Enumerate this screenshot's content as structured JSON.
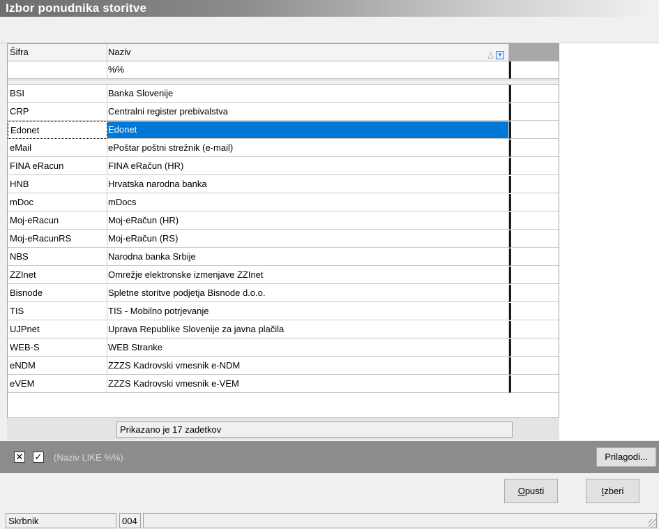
{
  "window": {
    "title": "Izbor ponudnika storitve"
  },
  "grid": {
    "headers": {
      "code": "Šifra",
      "name": "Naziv"
    },
    "filter": {
      "code": "",
      "name": "%%"
    },
    "rows": [
      {
        "code": "BSI",
        "name": "Banka Slovenije"
      },
      {
        "code": "CRP",
        "name": "Centralni register prebivalstva"
      },
      {
        "code": "Edonet",
        "name": "Edonet"
      },
      {
        "code": "eMail",
        "name": "ePoštar poštni strežnik (e-mail)"
      },
      {
        "code": "FINA eRacun",
        "name": "FINA eRačun (HR)"
      },
      {
        "code": "HNB",
        "name": "Hrvatska narodna banka"
      },
      {
        "code": "mDoc",
        "name": "mDocs"
      },
      {
        "code": "Moj-eRacun",
        "name": "Moj-eRačun (HR)"
      },
      {
        "code": "Moj-eRacunRS",
        "name": "Moj-eRačun (RS)"
      },
      {
        "code": "NBS",
        "name": "Narodna banka Srbije"
      },
      {
        "code": "ZZInet",
        "name": "Omrežje elektronske izmenjave ZZInet"
      },
      {
        "code": "Bisnode",
        "name": "Spletne storitve podjetja Bisnode d.o.o."
      },
      {
        "code": "TIS",
        "name": "TIS - Mobilno potrjevanje"
      },
      {
        "code": "UJPnet",
        "name": "Uprava Republike Slovenije za javna plačila"
      },
      {
        "code": "WEB-S",
        "name": "WEB Stranke"
      },
      {
        "code": "eNDM",
        "name": "ZZZS Kadrovski vmesnik e-NDM"
      },
      {
        "code": "eVEM",
        "name": "ZZZS Kadrovski vmesnik e-VEM"
      }
    ],
    "selected_index": 2,
    "count_text": "Prikazano je 17 zadetkov"
  },
  "filterbar": {
    "clear_icon": "close-icon",
    "enable_icon": "checkmark-icon",
    "expression": "(Naziv LIKE %%)",
    "customize_label": "Prilagodi..."
  },
  "buttons": {
    "cancel_prefix": "O",
    "cancel_rest": "pusti",
    "select_prefix": "I",
    "select_rest": "zberi"
  },
  "status": {
    "role": "Skrbnik",
    "code": "004"
  },
  "colors": {
    "selection": "#0078d7",
    "filterbar": "#8c8c8c"
  }
}
